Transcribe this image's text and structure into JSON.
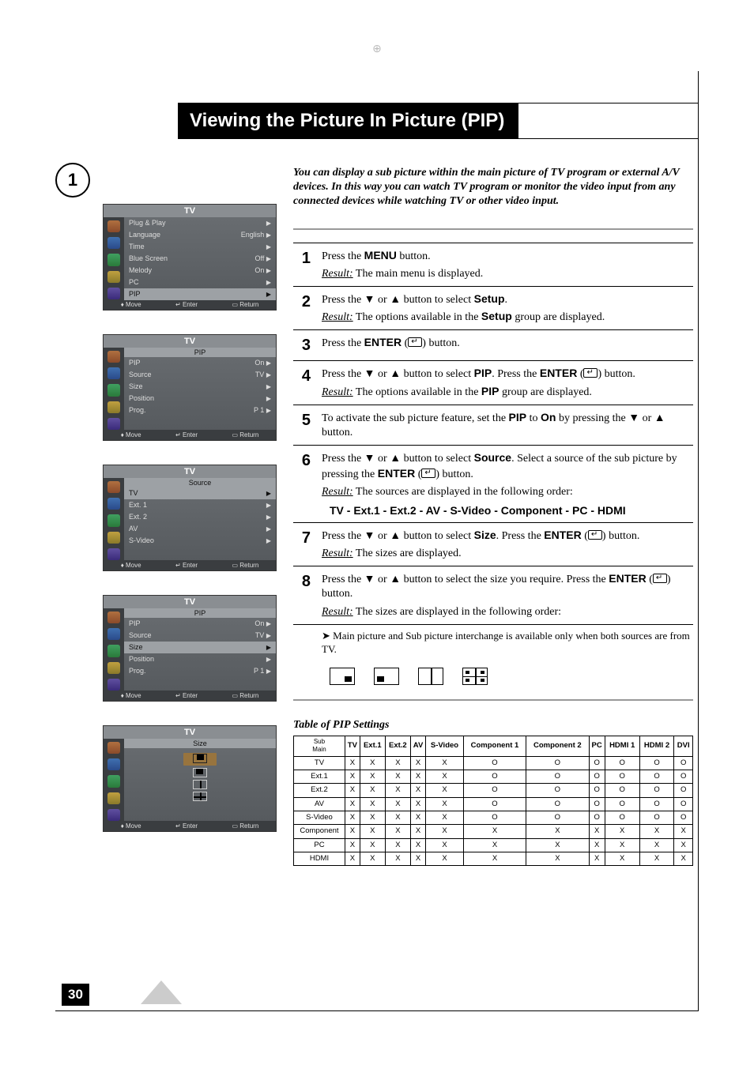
{
  "title": "Viewing the Picture In Picture (PIP)",
  "step_circle": "1",
  "intro": "You can display a sub picture within the main picture of TV program or external A/V devices. In this way you can watch TV program or monitor the video input from any connected devices while watching TV or other video input.",
  "osd_foot": {
    "move": "Move",
    "enter": "Enter",
    "return": "Return"
  },
  "osd1": {
    "head": "TV",
    "rows": [
      {
        "l": "Plug & Play",
        "r": ""
      },
      {
        "l": "Language",
        "r": "English"
      },
      {
        "l": "Time",
        "r": ""
      },
      {
        "l": "Blue Screen",
        "r": "Off"
      },
      {
        "l": "Melody",
        "r": "On"
      },
      {
        "l": "PC",
        "r": ""
      },
      {
        "l": "PIP",
        "r": "",
        "sel": true
      }
    ]
  },
  "osd2": {
    "head": "TV",
    "center_label": "PIP",
    "rows": [
      {
        "l": "PIP",
        "r": "On"
      },
      {
        "l": "Source",
        "r": "TV"
      },
      {
        "l": "Size",
        "r": ""
      },
      {
        "l": "Position",
        "r": ""
      },
      {
        "l": "Prog.",
        "r": "P 1"
      }
    ]
  },
  "osd3": {
    "head": "TV",
    "center_label": "Source",
    "rows": [
      {
        "l": "TV",
        "r": "",
        "sel": true
      },
      {
        "l": "Ext. 1",
        "r": ""
      },
      {
        "l": "Ext. 2",
        "r": ""
      },
      {
        "l": "AV",
        "r": ""
      },
      {
        "l": "S-Video",
        "r": ""
      }
    ]
  },
  "osd4": {
    "head": "TV",
    "center_label": "PIP",
    "rows": [
      {
        "l": "PIP",
        "r": "On"
      },
      {
        "l": "Source",
        "r": "TV"
      },
      {
        "l": "Size",
        "r": "",
        "sel": true
      },
      {
        "l": "Position",
        "r": ""
      },
      {
        "l": "Prog.",
        "r": "P 1"
      }
    ]
  },
  "osd5": {
    "head": "TV",
    "center_label": "Size",
    "sizes": [
      "s",
      "m",
      "db",
      "quad"
    ]
  },
  "steps": [
    {
      "n": "1",
      "t": "Press the <b>MENU</b> button.",
      "res": "The main menu is displayed."
    },
    {
      "n": "2",
      "t": "Press the <span class='inline-arrow'>▼</span> or <span class='inline-arrow'>▲</span> button to select <b>Setup</b>.",
      "res": "The options available in the <b>Setup</b> group are displayed."
    },
    {
      "n": "3",
      "t": "Press the <b>ENTER</b> (<span class='enter-ic'></span>) button."
    },
    {
      "n": "4",
      "t": "Press the <span class='inline-arrow'>▼</span> or <span class='inline-arrow'>▲</span> button to select <b>PIP</b>. Press the <b>ENTER</b> (<span class='enter-ic'></span>) button.",
      "res": "The options available in the <b>PIP</b> group are displayed."
    },
    {
      "n": "5",
      "t": "To activate the sub picture feature, set the <b>PIP</b> to <b>On</b> by pressing the <span class='inline-arrow'>▼</span> or <span class='inline-arrow'>▲</span> button."
    },
    {
      "n": "6",
      "t": "Press the <span class='inline-arrow'>▼</span> or <span class='inline-arrow'>▲</span> button to select <b>Source</b>. Select a source of the sub picture by pressing the <b>ENTER</b> (<span class='enter-ic'></span>) button.",
      "res": "The sources are displayed in the following order:",
      "srcline": "TV - Ext.1 - Ext.2 - AV - S-Video - Component - PC - HDMI"
    },
    {
      "n": "7",
      "t": "Press the <span class='inline-arrow'>▼</span> or <span class='inline-arrow'>▲</span> button to select <b>Size</b>. Press the <b>ENTER</b> (<span class='enter-ic'></span>) button.",
      "res": "The sizes are displayed."
    },
    {
      "n": "8",
      "t": "Press the <span class='inline-arrow'>▼</span> or <span class='inline-arrow'>▲</span> button to select the size you require. Press the <b>ENTER</b> (<span class='enter-ic'></span>) button.",
      "res": "The sizes are displayed in the following order:"
    }
  ],
  "main_note": "Main picture and Sub picture interchange is available only when both sources are from TV.",
  "tbl_title": "Table of PIP Settings",
  "tbl": {
    "corner": "Sub\\Main",
    "headers": [
      "TV",
      "Ext.1",
      "Ext.2",
      "AV",
      "S-Video",
      "Component 1",
      "Component 2",
      "PC",
      "HDMI 1",
      "HDMI 2",
      "DVI"
    ],
    "rows": [
      {
        "l": "TV",
        "v": [
          "X",
          "X",
          "X",
          "X",
          "X",
          "O",
          "O",
          "O",
          "O",
          "O",
          "O"
        ]
      },
      {
        "l": "Ext.1",
        "v": [
          "X",
          "X",
          "X",
          "X",
          "X",
          "O",
          "O",
          "O",
          "O",
          "O",
          "O"
        ]
      },
      {
        "l": "Ext.2",
        "v": [
          "X",
          "X",
          "X",
          "X",
          "X",
          "O",
          "O",
          "O",
          "O",
          "O",
          "O"
        ]
      },
      {
        "l": "AV",
        "v": [
          "X",
          "X",
          "X",
          "X",
          "X",
          "O",
          "O",
          "O",
          "O",
          "O",
          "O"
        ]
      },
      {
        "l": "S-Video",
        "v": [
          "X",
          "X",
          "X",
          "X",
          "X",
          "O",
          "O",
          "O",
          "O",
          "O",
          "O"
        ]
      },
      {
        "l": "Component",
        "v": [
          "X",
          "X",
          "X",
          "X",
          "X",
          "X",
          "X",
          "X",
          "X",
          "X",
          "X"
        ]
      },
      {
        "l": "PC",
        "v": [
          "X",
          "X",
          "X",
          "X",
          "X",
          "X",
          "X",
          "X",
          "X",
          "X",
          "X"
        ]
      },
      {
        "l": "HDMI",
        "v": [
          "X",
          "X",
          "X",
          "X",
          "X",
          "X",
          "X",
          "X",
          "X",
          "X",
          "X"
        ]
      }
    ]
  },
  "page_number": "30"
}
